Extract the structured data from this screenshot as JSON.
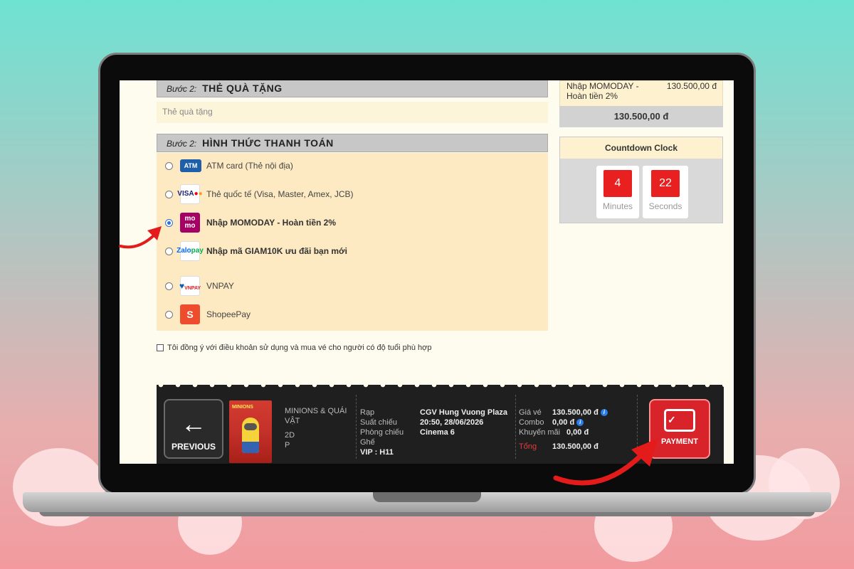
{
  "gift": {
    "step": "Bước 2:",
    "title": "THẺ QUÀ TẶNG",
    "placeholder": "Thẻ quà tặng"
  },
  "payment": {
    "step": "Bước 2:",
    "title": "HÌNH THỨC THANH TOÁN",
    "options": [
      {
        "label": "ATM card (Thẻ nội địa)",
        "logo": "ATM",
        "checked": false
      },
      {
        "label": "Thẻ quốc tế (Visa, Master, Amex, JCB)",
        "logo": "VISA",
        "checked": false
      },
      {
        "label": "Nhập MOMODAY - Hoàn tiền 2%",
        "logo": "mo mo",
        "checked": true
      },
      {
        "label": "Nhập mã GIAM10K ưu đãi bạn mới",
        "logo": "Zalo pay",
        "checked": false
      },
      {
        "label": "VNPAY",
        "logo": "VNPAY",
        "checked": false
      },
      {
        "label": "ShopeePay",
        "logo": "S",
        "checked": false
      }
    ]
  },
  "agree": {
    "label": "Tôi đồng ý với điều khoản sử dụng và mua vé cho người có độ tuổi phù hợp"
  },
  "summary": {
    "name": "Nhập MOMODAY - Hoàn tiền 2%",
    "price": "130.500,00 đ",
    "total": "130.500,00 đ"
  },
  "countdown": {
    "title": "Countdown Clock",
    "minutes": "4",
    "minutes_label": "Minutes",
    "seconds": "22",
    "seconds_label": "Seconds"
  },
  "bottom": {
    "previous_label": "PREVIOUS",
    "movie_title": "MINIONS & QUÁI VẬT",
    "format": "2D",
    "rating": "P",
    "poster_title": "MINIONS",
    "rap_label": "Rạp",
    "rap_value": "CGV Hung Vuong Plaza",
    "showtime_label": "Suất chiếu",
    "showtime_value": "20:50, 28/06/2026",
    "room_label": "Phòng chiếu",
    "room_value": "Cinema 6",
    "seat_label": "Ghế",
    "seat_value": "VIP : H11",
    "ticket_label": "Giá vé",
    "ticket_value": "130.500,00 đ",
    "combo_label": "Combo",
    "combo_value": "0,00 đ",
    "discount_label": "Khuyến mãi",
    "discount_value": "0,00 đ",
    "total_label": "Tổng",
    "total_value": "130.500,00 đ",
    "payment_label": "PAYMENT"
  },
  "colors": {
    "accent_red": "#e8201f",
    "radio_blue": "#2f6fdc",
    "panel_cream": "#fde9c2"
  }
}
